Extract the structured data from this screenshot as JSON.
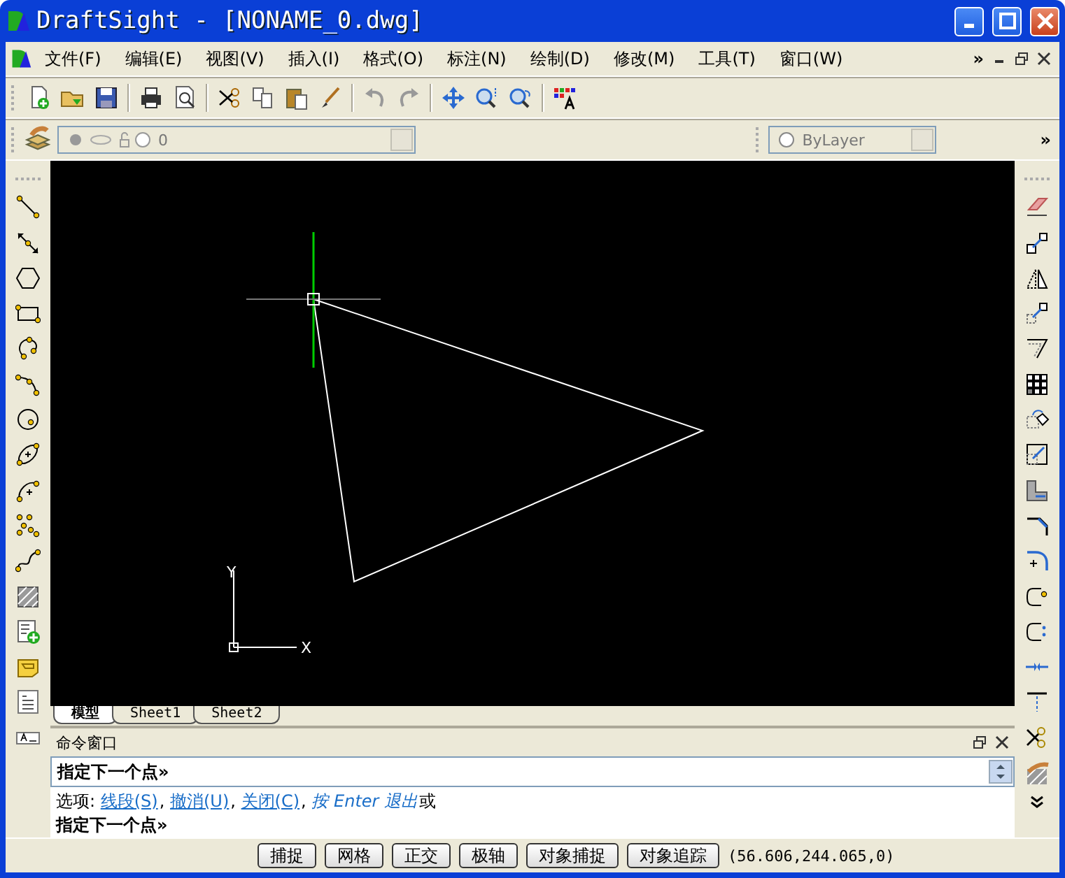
{
  "window": {
    "title": "DraftSight - [NONAME_0.dwg]"
  },
  "menu": [
    "文件(F)",
    "编辑(E)",
    "视图(V)",
    "插入(I)",
    "格式(O)",
    "标注(N)",
    "绘制(D)",
    "修改(M)",
    "工具(T)",
    "窗口(W)"
  ],
  "menu_overflow": "»",
  "toolbar_overflow": "»",
  "layer_combo": {
    "value": "0"
  },
  "color_combo": {
    "value": "ByLayer"
  },
  "canvas": {
    "ucs_x": "X",
    "ucs_y": "Y"
  },
  "tabs": [
    {
      "label": "模型",
      "selected": true
    },
    {
      "label": "Sheet1",
      "selected": false
    },
    {
      "label": "Sheet2",
      "selected": false
    }
  ],
  "command_window": {
    "title": "命令窗口",
    "prompt": "指定下一个点»",
    "options": [
      {
        "kind": "text",
        "text": "选项:"
      },
      {
        "kind": "link",
        "text": "线段(S)",
        "sep": ","
      },
      {
        "kind": "link",
        "text": "撤消(U)",
        "sep": ","
      },
      {
        "kind": "link",
        "text": "关闭(C)",
        "sep": ","
      },
      {
        "kind": "italic",
        "text": "按 Enter 退出"
      },
      {
        "kind": "text",
        "text": "或"
      }
    ],
    "last_prompt": "指定下一个点»"
  },
  "status_bar": {
    "buttons": [
      "捕捉",
      "网格",
      "正交",
      "极轴",
      "对象捕捉",
      "对象追踪"
    ],
    "coordinates": "(56.606,244.065,0)"
  }
}
